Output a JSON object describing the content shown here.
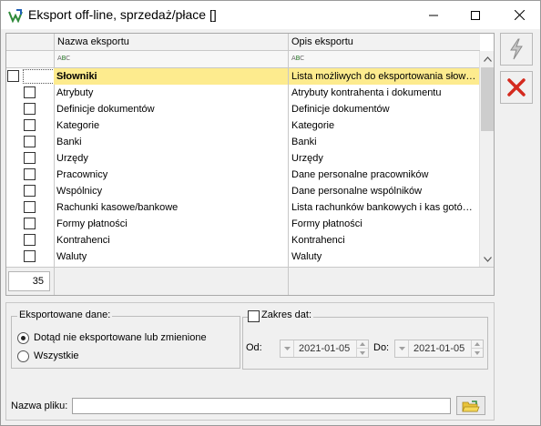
{
  "window": {
    "title": "Eksport off-line, sprzedaż/płace []"
  },
  "grid": {
    "columns": [
      {
        "label": "Nazwa eksportu"
      },
      {
        "label": "Opis eksportu"
      }
    ],
    "filter_icon": "abc-filter-icon",
    "filter_icon_text": "ABC",
    "rows": [
      {
        "name": "Słowniki",
        "desc": "Lista możliwych do eksportowania słown…",
        "selected": true
      },
      {
        "name": "Atrybuty",
        "desc": "Atrybuty kontrahenta i dokumentu"
      },
      {
        "name": "Definicje dokumentów",
        "desc": "Definicje dokumentów"
      },
      {
        "name": "Kategorie",
        "desc": "Kategorie"
      },
      {
        "name": "Banki",
        "desc": "Banki"
      },
      {
        "name": "Urzędy",
        "desc": "Urzędy"
      },
      {
        "name": "Pracownicy",
        "desc": "Dane personalne pracowników"
      },
      {
        "name": "Wspólnicy",
        "desc": "Dane personalne wspólników"
      },
      {
        "name": "Rachunki kasowe/bankowe",
        "desc": "Lista rachunków bankowych i kas gotów…"
      },
      {
        "name": "Formy płatności",
        "desc": "Formy płatności"
      },
      {
        "name": "Kontrahenci",
        "desc": "Kontrahenci"
      },
      {
        "name": "Waluty",
        "desc": "Waluty"
      }
    ],
    "count": "35"
  },
  "exported_data": {
    "title": "Eksportowane dane:",
    "options": [
      {
        "label": "Dotąd nie eksportowane lub zmienione",
        "checked": true
      },
      {
        "label": "Wszystkie",
        "checked": false
      }
    ]
  },
  "date_range": {
    "label": "Zakres dat:",
    "checked": false,
    "from_label": "Od:",
    "from_value": "2021-01-05",
    "to_label": "Do:",
    "to_value": "2021-01-05"
  },
  "file": {
    "label": "Nazwa pliku:",
    "value": ""
  },
  "colors": {
    "selection": "#fdeb8e",
    "cancel_red": "#d42a1e"
  }
}
